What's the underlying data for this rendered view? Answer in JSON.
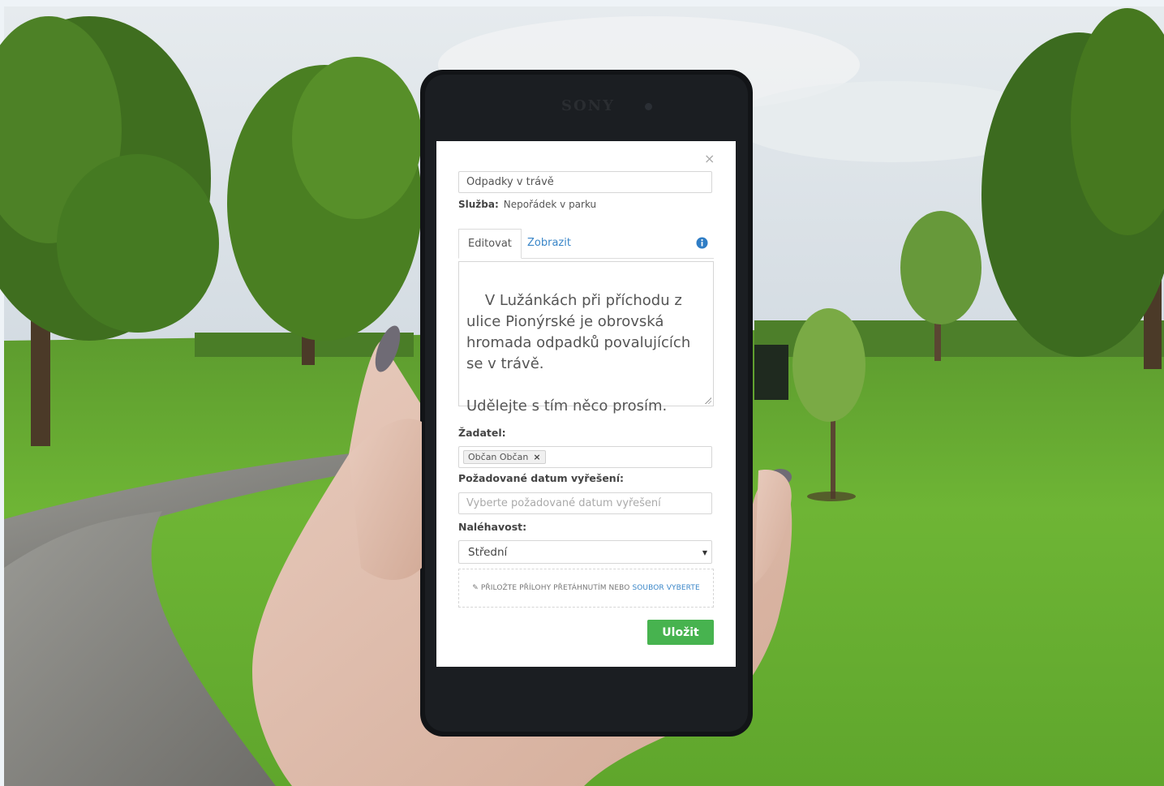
{
  "phone": {
    "brand": "SONY"
  },
  "form": {
    "close_label": "×",
    "title_value": "Odpadky v trávě",
    "service": {
      "label": "Služba:",
      "value": "Nepořádek v parku"
    },
    "tabs": [
      {
        "label": "Editovat",
        "active": true
      },
      {
        "label": "Zobrazit",
        "active": false
      }
    ],
    "description": "V Lužánkách při příchodu z ulice Pionýrské je obrovská hromada odpadků povalujících se v trávě.\n\nUdělejte s tím něco prosím.",
    "applicant": {
      "label": "Žadatel:",
      "tag": "Občan Občan",
      "tag_remove": "×"
    },
    "due_date": {
      "label": "Požadované datum vyřešení:",
      "placeholder": "Vyberte požadované datum vyřešení"
    },
    "urgency": {
      "label": "Naléhavost:",
      "selected": "Střední"
    },
    "attachments": {
      "text": "PŘILOŽTE PŘÍLOHY PŘETÁHNUTÍM NEBO",
      "link": "SOUBOR VYBERTE"
    },
    "save_label": "Uložit"
  },
  "colors": {
    "accent_blue": "#3a86c8",
    "save_green": "#47b34f",
    "info_blue": "#2f7dc5"
  }
}
